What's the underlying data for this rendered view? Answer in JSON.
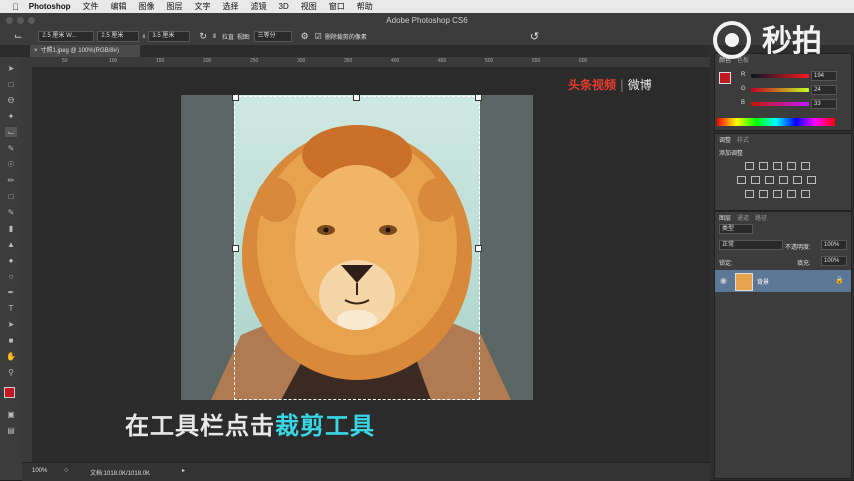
{
  "menubar": {
    "app_name": "Photoshop",
    "items": [
      "文件",
      "编辑",
      "图像",
      "图层",
      "文字",
      "选择",
      "滤镜",
      "3D",
      "视图",
      "窗口",
      "帮助"
    ]
  },
  "titlebar": {
    "title": "Adobe Photoshop CS6"
  },
  "options": {
    "preset": "2.5 厘米 W...",
    "width": "2.5 厘米",
    "times": "x",
    "height": "3.5 厘米",
    "straighten_label": "拉直",
    "view_label": "视图:",
    "view_value": "三等分",
    "delete_cropped_label": "删除裁剪的像素"
  },
  "document": {
    "tab_title": "寸照1.jpeg @ 100%(RGB/8#)",
    "zoom": "100%",
    "doc_info": "文档:1018.0K/1018.0K",
    "ruler_ticks": [
      "50",
      "100",
      "150",
      "200",
      "250",
      "300",
      "350",
      "400",
      "450",
      "500",
      "550",
      "600"
    ]
  },
  "subtitle": {
    "prefix": "在工具栏点击",
    "highlight": "裁剪工具"
  },
  "watermark": {
    "text": "秒拍",
    "weibo": "微博",
    "brand": "头条视频"
  },
  "color_panel": {
    "tabs": [
      "颜色",
      "色板"
    ],
    "r_label": "R",
    "g_label": "G",
    "b_label": "B",
    "r": "194",
    "g": "24",
    "b": "33",
    "fg_color": "#c21821",
    "bg_color": "#ffffff"
  },
  "adjust_panel": {
    "tabs": [
      "调整",
      "样式"
    ],
    "add_label": "添加调整"
  },
  "layers_panel": {
    "tabs": [
      "图层",
      "通道",
      "路径"
    ],
    "kind": "类型",
    "blend": "正常",
    "opacity_label": "不透明度:",
    "opacity": "100%",
    "lock_label": "锁定:",
    "fill_label": "填充:",
    "fill": "100%",
    "layer_name": "背景"
  }
}
